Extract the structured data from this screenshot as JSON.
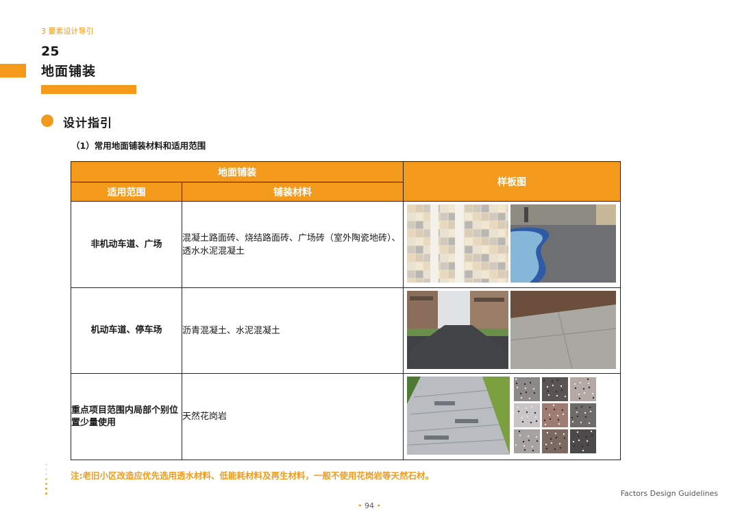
{
  "header": {
    "section_label": "3  要素设计导引",
    "chapter_number": "25",
    "chapter_title": "地面铺装"
  },
  "guide": {
    "title": "设计指引",
    "subtitle": "（1）常用地面铺装材料和适用范围"
  },
  "table": {
    "group_header": "地面铺装",
    "col_scope": "适用范围",
    "col_material": "铺装材料",
    "col_sample": "样板图",
    "rows": [
      {
        "scope": "非机动车道、广场",
        "material": "混凝土路面砖、烧结路面砖、广场砖（室外陶瓷地砖）、透水水泥混凝土",
        "images": [
          "tile-grid-photo",
          "permeable-concrete-path-photo"
        ]
      },
      {
        "scope": "机动车道、停车场",
        "material": "沥青混凝土、水泥混凝土",
        "images": [
          "asphalt-road-photo",
          "cement-concrete-road-photo"
        ]
      },
      {
        "scope": "重点项目范围内局部个别位置少量使用",
        "material": "天然花岗岩",
        "images": [
          "granite-paved-path-photo",
          "granite-samples-photo"
        ]
      }
    ]
  },
  "note": "注:老旧小区改造应优先选用透水材料、低能耗材料及再生材料，一般不使用花岗岩等天然石材。",
  "footer": {
    "brand": "Factors Design Guidelines",
    "page": "94"
  },
  "colors": {
    "accent": "#f39a1d",
    "text": "#1a1a1a"
  }
}
